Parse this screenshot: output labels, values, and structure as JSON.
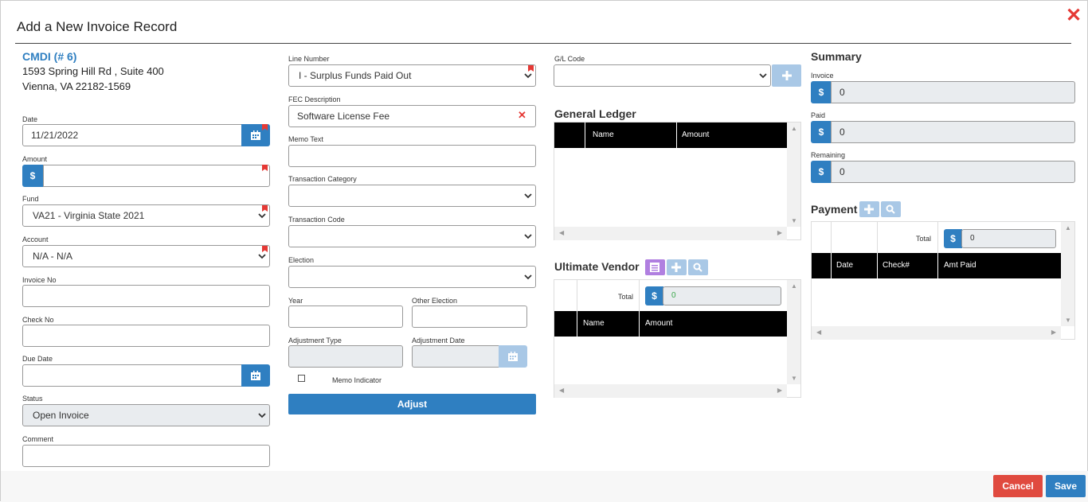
{
  "modal": {
    "title": "Add a New Invoice Record"
  },
  "vendor": {
    "name": "CMDI (# 6)",
    "address_line1": "1593 Spring Hill Rd , Suite 400",
    "address_line2": "Vienna, VA 22182-1569"
  },
  "left_form": {
    "date_label": "Date",
    "date_value": "11/21/2022",
    "amount_label": "Amount",
    "amount_value": "",
    "currency_symbol": "$",
    "fund_label": "Fund",
    "fund_value": "VA21 - Virginia State 2021",
    "account_label": "Account",
    "account_value": "N/A - N/A",
    "invoice_no_label": "Invoice No",
    "invoice_no_value": "",
    "check_no_label": "Check No",
    "check_no_value": "",
    "due_date_label": "Due Date",
    "due_date_value": "",
    "status_label": "Status",
    "status_value": "Open Invoice",
    "comment_label": "Comment",
    "comment_value": ""
  },
  "middle_form": {
    "line_number_label": "Line Number",
    "line_number_value": "I - Surplus Funds Paid Out",
    "fec_description_label": "FEC Description",
    "fec_description_value": "Software License Fee",
    "memo_text_label": "Memo Text",
    "memo_text_value": "",
    "transaction_category_label": "Transaction Category",
    "transaction_category_value": "",
    "transaction_code_label": "Transaction Code",
    "transaction_code_value": "",
    "election_label": "Election",
    "election_value": "",
    "year_label": "Year",
    "year_value": "",
    "other_election_label": "Other Election",
    "other_election_value": "",
    "adjustment_type_label": "Adjustment Type",
    "adjustment_type_value": "",
    "adjustment_date_label": "Adjustment Date",
    "adjustment_date_value": "",
    "memo_indicator_label": "Memo Indicator",
    "adjust_button": "Adjust"
  },
  "gl": {
    "gl_code_label": "G/L Code",
    "gl_code_value": "",
    "general_ledger_title": "General Ledger",
    "columns": [
      "Name",
      "Amount"
    ]
  },
  "ultimate_vendor": {
    "title": "Ultimate Vendor",
    "total_label": "Total",
    "total_value": "0",
    "currency_symbol": "$",
    "columns": [
      "Name",
      "Amount"
    ]
  },
  "summary": {
    "title": "Summary",
    "invoice_label": "Invoice",
    "invoice_value": "0",
    "paid_label": "Paid",
    "paid_value": "0",
    "remaining_label": "Remaining",
    "remaining_value": "0",
    "currency_symbol": "$"
  },
  "payment": {
    "title": "Payment",
    "total_label": "Total",
    "total_value": "0",
    "currency_symbol": "$",
    "columns": [
      "Date",
      "Check#",
      "Amt Paid"
    ]
  },
  "footer": {
    "cancel_label": "Cancel",
    "save_label": "Save"
  },
  "colors": {
    "primary": "#2f7fc1",
    "danger": "#e04a3f",
    "required_flag": "#e53935",
    "purple_button": "#b07fe0"
  }
}
